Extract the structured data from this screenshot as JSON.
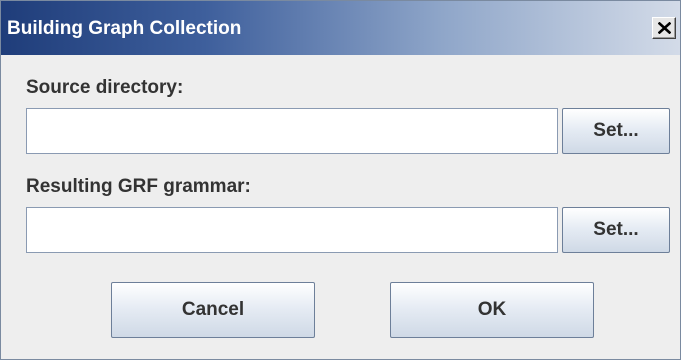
{
  "window": {
    "title": "Building Graph Collection",
    "close_symbol": "X"
  },
  "source": {
    "label": "Source directory:",
    "value": "",
    "set_label": "Set..."
  },
  "result": {
    "label": "Resulting GRF grammar:",
    "value": "",
    "set_label": "Set..."
  },
  "buttons": {
    "cancel_label": "Cancel",
    "ok_label": "OK"
  },
  "icons": {
    "close": "close-icon"
  }
}
